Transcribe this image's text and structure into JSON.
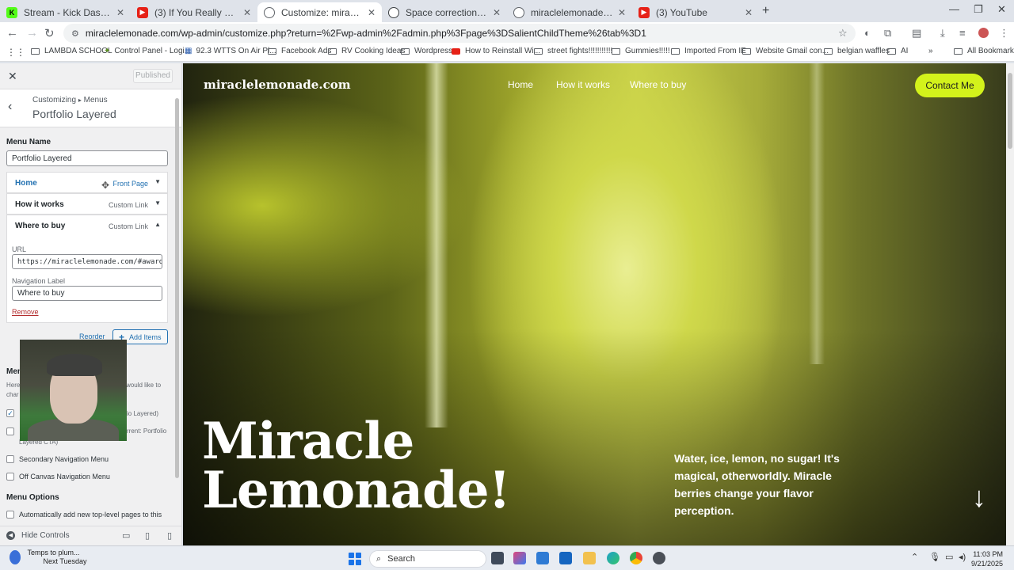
{
  "browser": {
    "tabs": [
      {
        "title": "Stream - Kick Dashboard",
        "active": false
      },
      {
        "title": "(3) If You Really Love Me - YouT",
        "active": false
      },
      {
        "title": "Customize: miraclelemonade.co",
        "active": true
      },
      {
        "title": "Space correction advice",
        "active": false
      },
      {
        "title": "miraclelemonade.com",
        "active": false
      },
      {
        "title": "(3) YouTube",
        "active": false
      }
    ],
    "url": "miraclelemonade.com/wp-admin/customize.php?return=%2Fwp-admin%2Fadmin.php%3Fpage%3DSalientChildTheme%26tab%3D1",
    "bookmarks": [
      "LAMBDA SCHOOL",
      "Control Panel - Logi...",
      "92.3 WTTS On Air Pl...",
      "Facebook Ads",
      "RV Cooking Ideas",
      "Wordpress",
      "How to Reinstall Wi...",
      "street fights!!!!!!!!!!!",
      "Gummies!!!!!",
      "Imported From IE",
      "Website Gmail con...",
      "belgian waffles",
      "AI"
    ],
    "all_bookmarks": "All Bookmarks"
  },
  "customizer": {
    "published": "Published",
    "breadcrumb_root": "Customizing",
    "breadcrumb_sep": "▸",
    "breadcrumb_section": "Menus",
    "title": "Portfolio Layered",
    "menu_name_label": "Menu Name",
    "menu_name_value": "Portfolio Layered",
    "items": [
      {
        "title": "Home",
        "type": "Front Page"
      },
      {
        "title": "How it works",
        "type": "Custom Link"
      },
      {
        "title": "Where to buy",
        "type": "Custom Link"
      }
    ],
    "url_label": "URL",
    "url_value": "https://miraclelemonade.com/#awards",
    "nav_label_label": "Navigation Label",
    "nav_label_value": "Where to buy",
    "remove": "Remove",
    "reorder": "Reorder",
    "add_items": "Add Items",
    "menu_locations_head": "Menu Locations",
    "locations_desc_a": "Here",
    "locations_desc_b": "would like to",
    "locations_desc_c": "char",
    "loc_primary_tail": "io Layered)",
    "loc_cta_tail": "rrent: Portfolio",
    "loc_cta_tail2": "Layered CTA)",
    "loc_secondary": "Secondary Navigation Menu",
    "loc_offcanvas": "Off Canvas Navigation Menu",
    "menu_options_head": "Menu Options",
    "auto_add": "Automatically add new top-level pages to this",
    "hide_controls": "Hide Controls"
  },
  "site": {
    "logo": "miraclelemonade.com",
    "nav": [
      "Home",
      "How it works",
      "Where to buy"
    ],
    "contact": "Contact Me",
    "hero_title": "Miracle Lemonade!",
    "hero_sub": "Water, ice, lemon, no sugar! It's magical, otherworldly. Miracle berries change your flavor perception."
  },
  "taskbar": {
    "weather_line1": "Temps to plum...",
    "weather_line2": "Next Tuesday",
    "search": "Search",
    "time": "11:03 PM",
    "date": "9/21/2025"
  },
  "colors": {
    "accent_contact": "#d3f21b",
    "wp_link": "#2271b1",
    "remove": "#b32d2e"
  }
}
